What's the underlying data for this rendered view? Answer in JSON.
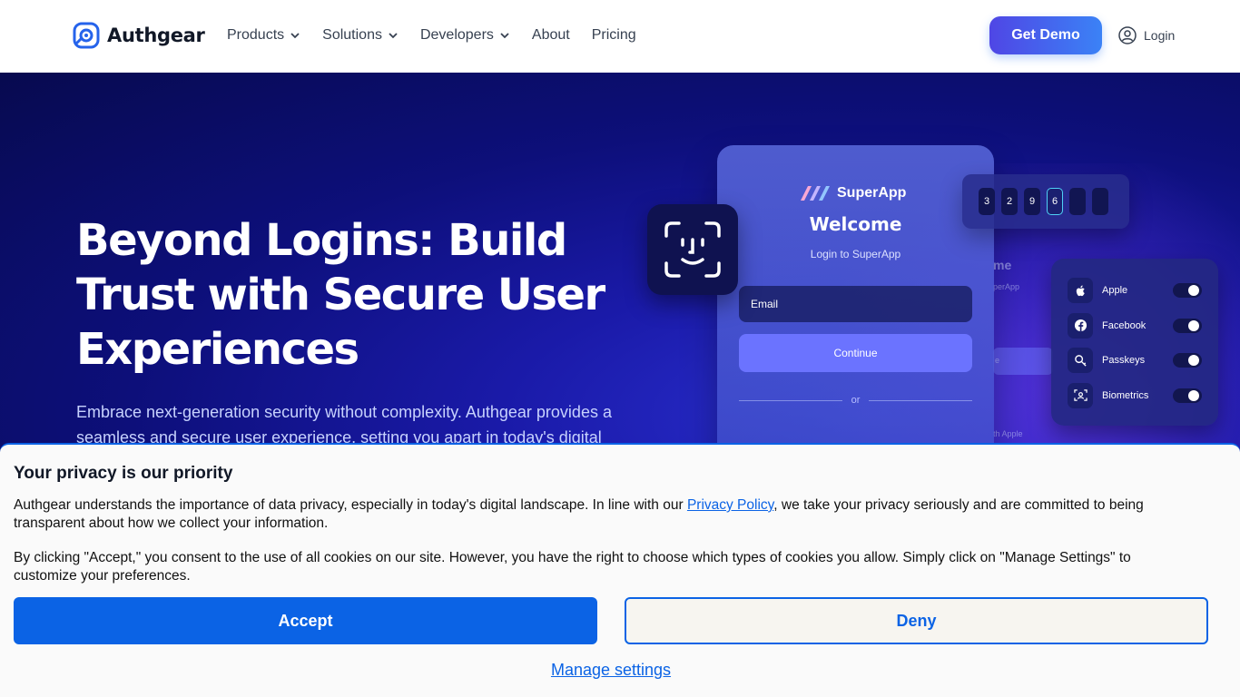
{
  "header": {
    "logo_text": "Authgear",
    "nav": [
      {
        "label": "Products",
        "dropdown": true
      },
      {
        "label": "Solutions",
        "dropdown": true
      },
      {
        "label": "Developers",
        "dropdown": true
      },
      {
        "label": "About",
        "dropdown": false
      },
      {
        "label": "Pricing",
        "dropdown": false
      }
    ],
    "demo_label": "Get Demo",
    "login_label": "Login"
  },
  "hero": {
    "title": "Beyond Logins: Build Trust with Secure User Experiences",
    "subtitle": "Embrace next-generation security without complexity. Authgear provides a seamless and secure user experience, setting you apart in today's digital"
  },
  "mockup": {
    "brand": "SuperApp",
    "welcome": "Welcome",
    "login_sub": "Login to SuperApp",
    "email_label": "Email",
    "continue_label": "Continue",
    "or_label": "or",
    "otp_digits": [
      "3",
      "2",
      "9",
      "6",
      "",
      ""
    ],
    "ghost_title": "me",
    "ghost_sub": "perApp",
    "ghost_apple": "th Apple",
    "ghost_e": "e",
    "providers": [
      {
        "label": "Apple",
        "icon": "apple-icon"
      },
      {
        "label": "Facebook",
        "icon": "facebook-icon"
      },
      {
        "label": "Passkeys",
        "icon": "passkey-icon"
      },
      {
        "label": "Biometrics",
        "icon": "biometrics-icon"
      }
    ]
  },
  "cookie": {
    "title": "Your privacy is our priority",
    "p1_before": "Authgear understands the importance of data privacy, especially in today's digital landscape. In line with our ",
    "p1_link": "Privacy Policy",
    "p1_after": ", we take your privacy seriously and are committed to being transparent about how we collect your information.",
    "p2": "By clicking \"Accept,\" you consent to the use of all cookies on our site. However, you have the right to choose which types of cookies you allow. Simply click on \"Manage Settings\" to customize your preferences.",
    "accept_label": "Accept",
    "deny_label": "Deny",
    "manage_label": "Manage settings"
  },
  "colors": {
    "accent": "#0b63e5",
    "hero_bg": "#0d0f7a",
    "demo_gradient_start": "#4f46e5",
    "demo_gradient_end": "#3b82f6"
  }
}
